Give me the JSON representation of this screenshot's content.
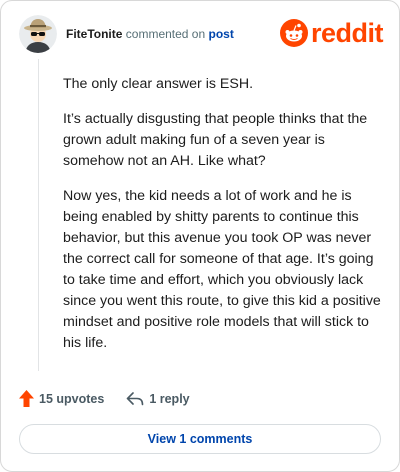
{
  "comment": {
    "username": "FiteTonite",
    "action_text": "commented on",
    "target_link": "post",
    "paragraphs": [
      "The only clear answer is ESH.",
      "It’s actually disgusting that people thinks that the grown adult making fun of a seven year is somehow not an AH. Like what?",
      "Now yes, the kid needs a lot of work and he is being enabled by shitty parents to continue this behavior, but this avenue you took OP was never the correct call for someone of that age. It’s going to take time and effort, which you obviously lack since you went this route, to give this kid a positive mindset and positive role models that will stick to his life."
    ],
    "upvotes_label": "15 upvotes",
    "replies_label": "1 reply",
    "view_comments_label": "View 1 comments"
  },
  "brand": {
    "wordmark": "reddit",
    "color": "#ff4500"
  },
  "icons": {
    "avatar": "avatar-cowboy-hat-sunglasses",
    "upvote": "upvote-arrow-icon",
    "reply": "reply-arrow-icon",
    "logo": "reddit-snoo-icon"
  },
  "colors": {
    "link": "#0045ac",
    "upvote": "#ff4500",
    "text": "#1c1c1c",
    "muted": "#576f76"
  }
}
